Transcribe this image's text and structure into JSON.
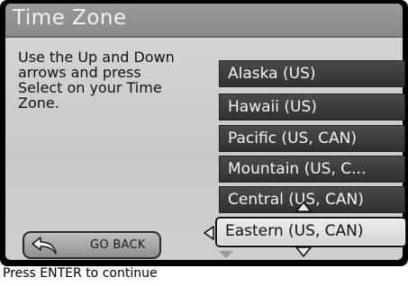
{
  "header": {
    "title": "Time Zone"
  },
  "instructions": "Use the Up and Down arrows and press Select on your Time Zone.",
  "time_zones": [
    {
      "label": "Alaska (US)",
      "selected": false
    },
    {
      "label": "Hawaii (US)",
      "selected": false
    },
    {
      "label": "Pacific (US, CAN)",
      "selected": false
    },
    {
      "label": "Mountain (US, C...",
      "selected": false
    },
    {
      "label": "Central (US, CAN)",
      "selected": false
    },
    {
      "label": "Eastern (US, CAN)",
      "selected": true
    }
  ],
  "back_button": {
    "label": "GO BACK",
    "icon": "back-arrow-icon"
  },
  "status_bar": {
    "text": "Press ENTER to continue"
  },
  "colors": {
    "title_bar": "#8a8a8a",
    "list_item": "#3a3a3a",
    "selected_item": "#e0e0e0",
    "panel": "#cccccc"
  }
}
